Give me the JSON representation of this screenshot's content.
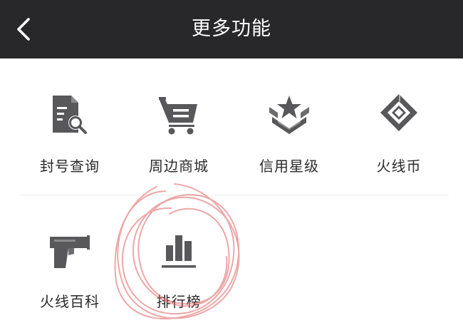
{
  "header": {
    "title": "更多功能",
    "back_icon": "chevron-left-icon"
  },
  "colors": {
    "header_bg": "#28282a",
    "icon_gray": "#58585b",
    "label_text": "#2a2a2a",
    "annotation_red": "#e06060"
  },
  "features": [
    {
      "label": "封号查询",
      "icon": "document-search-icon"
    },
    {
      "label": "周边商城",
      "icon": "shopping-cart-icon"
    },
    {
      "label": "信用星级",
      "icon": "star-rank-badge-icon"
    },
    {
      "label": "火线币",
      "icon": "diamond-coin-icon"
    },
    {
      "label": "火线百科",
      "icon": "pistol-icon"
    },
    {
      "label": "排行榜",
      "icon": "bar-chart-icon"
    }
  ]
}
